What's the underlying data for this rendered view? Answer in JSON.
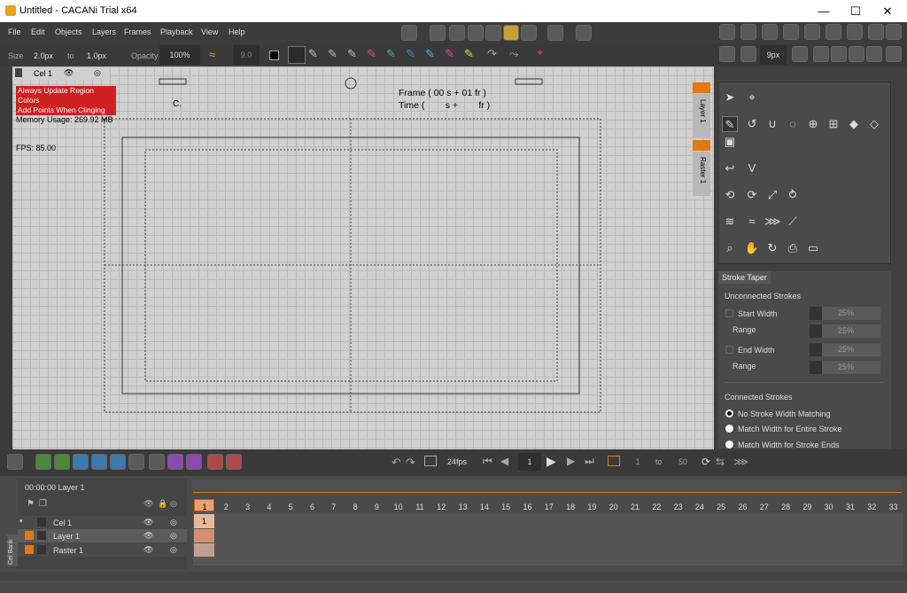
{
  "window": {
    "title": "Untitled - CACANi Trial  x64",
    "min": "—",
    "max": "☐",
    "close": "✕"
  },
  "menu": [
    "File",
    "Edit",
    "Objects",
    "Layers",
    "Frames",
    "Playback",
    "View",
    "Help"
  ],
  "options": {
    "size_label": "Size",
    "size_from": "2.0px",
    "to_label": "to",
    "size_to": "1.0px",
    "opacity_label": "Opacity",
    "opacity_value": "100%",
    "smooth_value": "9.0"
  },
  "right_toolbar": {
    "px_value": "9px"
  },
  "canvas": {
    "cel_label": "Cel 1",
    "red_line1": "Always Update Region Colors",
    "red_line2": "Add Points When Clinging",
    "memory": "Memory Usage: 269.92 MB",
    "fps": "FPS: 85.00",
    "c_label": "C.",
    "frame_text": "Frame ( 00 s + 01 fr )",
    "time_text": "Time (        s +        fr )"
  },
  "side_tabs": {
    "layer": "Layer 1",
    "raster": "Raster 1"
  },
  "stroke_taper": {
    "tab": "Stroke Taper",
    "unconnected": "Unconnected Strokes",
    "start_width": "Start Width",
    "start_width_val": "25%",
    "range1": "Range",
    "range1_val": "25%",
    "end_width": "End Width",
    "end_width_val": "25%",
    "range2": "Range",
    "range2_val": "25%",
    "connected": "Connected Strokes",
    "opt1": "No Stroke Width Matching",
    "opt2": "Match Width for Entire Stroke",
    "opt3": "Match Width for Stroke Ends"
  },
  "playback": {
    "fps": "24fps",
    "frame": "1",
    "range_from": "1",
    "range_to_label": "to",
    "range_to": "50"
  },
  "timeline": {
    "header": "00:00:00  Layer 1",
    "layers": [
      "Cel 1",
      "Layer 1",
      "Raster 1"
    ],
    "frames": [
      "1",
      "2",
      "3",
      "4",
      "5",
      "6",
      "7",
      "8",
      "9",
      "10",
      "11",
      "12",
      "13",
      "14",
      "15",
      "16",
      "17",
      "18",
      "19",
      "20",
      "21",
      "22",
      "23",
      "24",
      "25",
      "26",
      "27",
      "28",
      "29",
      "30",
      "31",
      "32",
      "33"
    ],
    "cel_frame": "1",
    "cel_bank": "Cel Bank"
  }
}
